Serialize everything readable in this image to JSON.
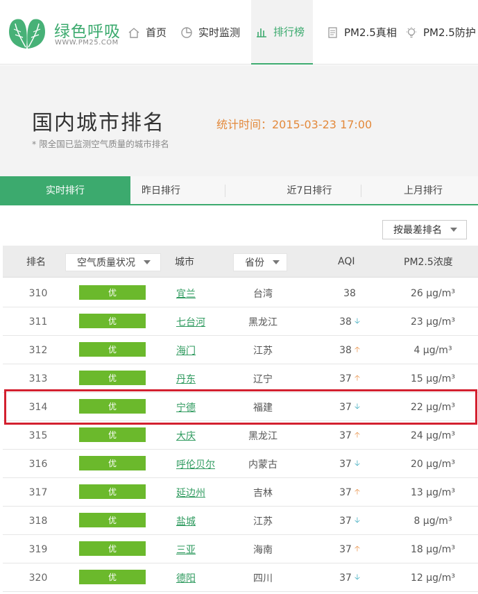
{
  "header": {
    "logo_text": "绿色呼吸",
    "logo_url": "WWW.PM25.COM",
    "nav": [
      {
        "label": "首页",
        "icon": "home-icon"
      },
      {
        "label": "实时监测",
        "icon": "pie-chart-icon"
      },
      {
        "label": "排行榜",
        "icon": "bar-chart-icon"
      },
      {
        "label": "PM2.5真相",
        "icon": "document-icon"
      },
      {
        "label": "PM2.5防护",
        "icon": "lightbulb-icon"
      }
    ]
  },
  "title_area": {
    "title": "国内城市排名",
    "stat_time": "统计时间：2015-03-23 17:00",
    "subtitle": "* 限全国已监测空气质量的城市排名"
  },
  "tabs": [
    "实时排行",
    "昨日排行",
    "近7日排行",
    "上月排行"
  ],
  "sort": {
    "label": "按最差排名"
  },
  "table": {
    "headers": {
      "rank": "排名",
      "quality": "空气质量状况",
      "city": "城市",
      "province": "省份",
      "aqi": "AQI",
      "pm": "PM2.5浓度"
    },
    "rows": [
      {
        "rank": "310",
        "quality": "优",
        "city": "宜兰",
        "province": "台湾",
        "aqi": "38",
        "trend": "",
        "pm": "26 μg/m³"
      },
      {
        "rank": "311",
        "quality": "优",
        "city": "七台河",
        "province": "黑龙江",
        "aqi": "38",
        "trend": "down",
        "pm": "23 μg/m³"
      },
      {
        "rank": "312",
        "quality": "优",
        "city": "海门",
        "province": "江苏",
        "aqi": "38",
        "trend": "up",
        "pm": "4 μg/m³"
      },
      {
        "rank": "313",
        "quality": "优",
        "city": "丹东",
        "province": "辽宁",
        "aqi": "37",
        "trend": "up",
        "pm": "15 μg/m³"
      },
      {
        "rank": "314",
        "quality": "优",
        "city": "宁德",
        "province": "福建",
        "aqi": "37",
        "trend": "down",
        "pm": "22 μg/m³"
      },
      {
        "rank": "315",
        "quality": "优",
        "city": "大庆",
        "province": "黑龙江",
        "aqi": "37",
        "trend": "up",
        "pm": "24 μg/m³"
      },
      {
        "rank": "316",
        "quality": "优",
        "city": "呼伦贝尔",
        "province": "内蒙古",
        "aqi": "37",
        "trend": "down",
        "pm": "20 μg/m³"
      },
      {
        "rank": "317",
        "quality": "优",
        "city": "延边州",
        "province": "吉林",
        "aqi": "37",
        "trend": "up",
        "pm": "13 μg/m³"
      },
      {
        "rank": "318",
        "quality": "优",
        "city": "盐城",
        "province": "江苏",
        "aqi": "37",
        "trend": "down",
        "pm": "8 μg/m³"
      },
      {
        "rank": "319",
        "quality": "优",
        "city": "三亚",
        "province": "海南",
        "aqi": "37",
        "trend": "up",
        "pm": "18 μg/m³"
      },
      {
        "rank": "320",
        "quality": "优",
        "city": "德阳",
        "province": "四川",
        "aqi": "37",
        "trend": "down",
        "pm": "12 μg/m³"
      }
    ]
  },
  "colors": {
    "brand_green": "#3caa6e",
    "badge_good": "#6bb92c",
    "accent_orange": "#e3893b",
    "trend_down": "#29a2b7",
    "trend_up": "#e78b3e",
    "highlight_red": "#d3202f"
  }
}
